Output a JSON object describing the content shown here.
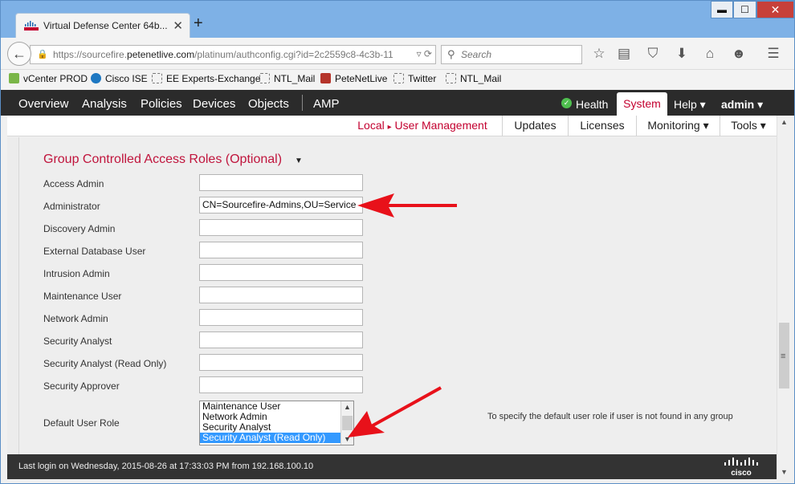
{
  "browser": {
    "tab_title": "Virtual Defense Center 64b...",
    "tab_close": "✕",
    "new_tab": "+",
    "url_prefix": "https://sourcefire.",
    "url_domain": "petenetlive.com",
    "url_suffix": "/platinum/authconfig.cgi?id=2c2559c8-4c3b-11",
    "search_placeholder": "Search",
    "window_controls": {
      "minimize": "▬",
      "maximize": "☐",
      "close": "✕"
    }
  },
  "bookmarks": [
    {
      "label": "vCenter PROD",
      "icon": "vcenter-icon",
      "color": "#7ab648"
    },
    {
      "label": "Cisco ISE",
      "icon": "cisco-ise-icon",
      "color": "#1e78c2"
    },
    {
      "label": "EE Experts-Exchange",
      "icon": "blank-page-icon",
      "color": ""
    },
    {
      "label": "NTL_Mail",
      "icon": "blank-page-icon",
      "color": ""
    },
    {
      "label": "PeteNetLive",
      "icon": "petenetlive-icon",
      "color": "#b5342a"
    },
    {
      "label": "Twitter",
      "icon": "blank-page-icon",
      "color": ""
    },
    {
      "label": "NTL_Mail",
      "icon": "blank-page-icon",
      "color": ""
    }
  ],
  "app_nav": {
    "items": [
      "Overview",
      "Analysis",
      "Policies",
      "Devices",
      "Objects",
      "AMP"
    ],
    "health": "Health",
    "system": "System",
    "help": "Help ▾",
    "user": "admin ▾"
  },
  "sub_nav": {
    "breadcrumb_local": "Local",
    "breadcrumb_sep": "▸",
    "breadcrumb_page": "User Management",
    "updates": "Updates",
    "licenses": "Licenses",
    "monitoring": "Monitoring ▾",
    "tools": "Tools ▾"
  },
  "section": {
    "title": "Group Controlled Access Roles (Optional)",
    "caret": "▼",
    "rows": [
      {
        "label": "Access Admin",
        "value": ""
      },
      {
        "label": "Administrator",
        "value": "CN=Sourcefire-Admins,OU=Service"
      },
      {
        "label": "Discovery Admin",
        "value": ""
      },
      {
        "label": "External Database User",
        "value": ""
      },
      {
        "label": "Intrusion Admin",
        "value": ""
      },
      {
        "label": "Maintenance User",
        "value": ""
      },
      {
        "label": "Network Admin",
        "value": ""
      },
      {
        "label": "Security Analyst",
        "value": ""
      },
      {
        "label": "Security Analyst (Read Only)",
        "value": ""
      },
      {
        "label": "Security Approver",
        "value": ""
      }
    ],
    "default_role_label": "Default User Role",
    "default_role_options": [
      "Maintenance User",
      "Network Admin",
      "Security Analyst",
      "Security Analyst (Read Only)"
    ],
    "default_role_selected": "Security Analyst (Read Only)",
    "help_text": "To specify the default user role if user is not found in any group"
  },
  "footer": {
    "last_login": "Last login on Wednesday, 2015-08-26 at 17:33:03 PM from 192.168.100.10",
    "logo_text": "cisco"
  },
  "colors": {
    "accent": "#c3002f",
    "appbar": "#2b2b2b",
    "annotation_arrow": "#e8111a"
  }
}
